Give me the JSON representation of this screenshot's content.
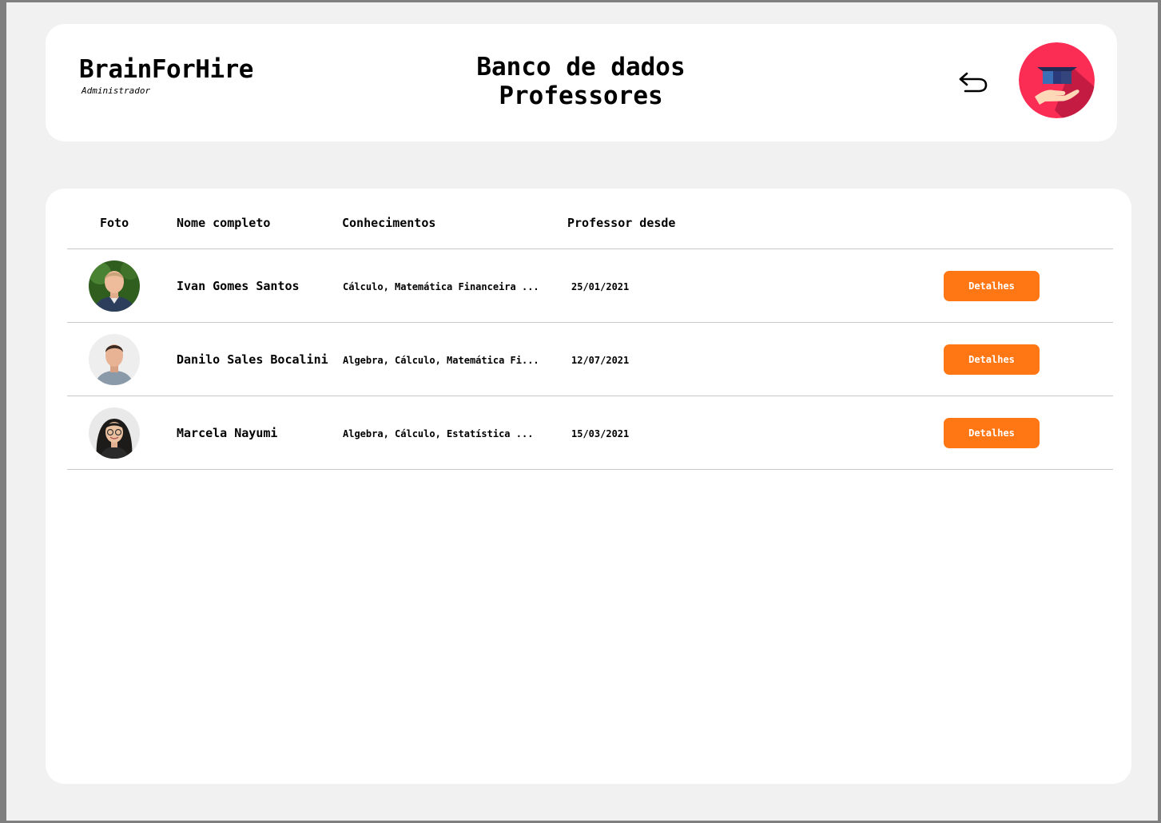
{
  "brand": {
    "name": "BrainForHire",
    "role": "Administrador"
  },
  "page": {
    "title_line1": "Banco de dados",
    "title_line2": "Professores"
  },
  "icons": {
    "back": "back-arrow-icon",
    "logo": "graduation-cap-hand-logo"
  },
  "colors": {
    "accent": "#ff7715",
    "logo_bg": "#fb2d55",
    "background": "#f1f1f1"
  },
  "table": {
    "columns": [
      "Foto",
      "Nome completo",
      "Conhecimentos",
      "Professor desde"
    ],
    "rows": [
      {
        "name": "Ivan Gomes Santos",
        "skills": "Cálculo, Matemática Financeira ...",
        "since": "25/01/2021",
        "action": "Detalhes"
      },
      {
        "name": "Danilo Sales Bocalini",
        "skills": "Algebra, Cálculo, Matemática Fi...",
        "since": "12/07/2021",
        "action": "Detalhes"
      },
      {
        "name": "Marcela Nayumi",
        "skills": "Algebra, Cálculo, Estatística  ...",
        "since": "15/03/2021",
        "action": "Detalhes"
      }
    ]
  }
}
